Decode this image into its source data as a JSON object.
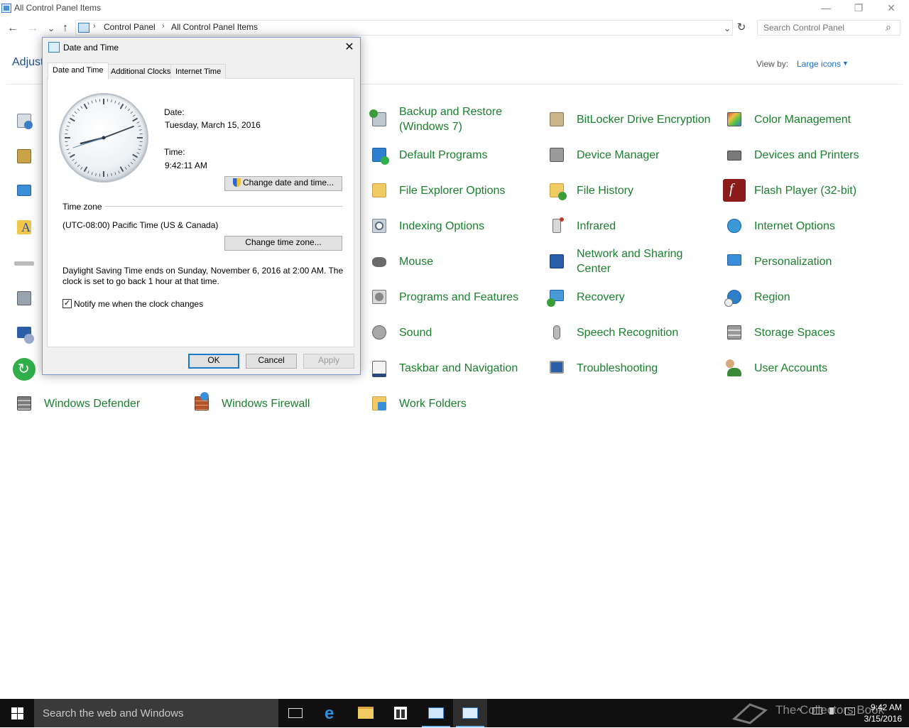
{
  "window": {
    "title": "All Control Panel Items",
    "minimize": "—",
    "restore": "❐",
    "close": "✕"
  },
  "nav": {
    "back": "←",
    "forward": "→",
    "recent": "⌄",
    "up": "↑",
    "breadcrumb": [
      "Control Panel",
      "All Control Panel Items"
    ],
    "separator": "›",
    "dropdown": "⌄",
    "refresh": "↻",
    "search_placeholder": "Search Control Panel",
    "search_icon": "⌕"
  },
  "header": {
    "adjust_text": "Adjust",
    "view_by_label": "View by:",
    "view_by_value": "Large icons",
    "view_by_caret": "▼"
  },
  "items": [
    {
      "label": "Backup and Restore (Windows 7)",
      "icon": "backup-icon",
      "color": "#3a9d3a"
    },
    {
      "label": "BitLocker Drive Encryption",
      "icon": "bitlocker-icon",
      "color": "#9a8a6a"
    },
    {
      "label": "Color Management",
      "icon": "color-management-icon",
      "color": "#5a7bd0"
    },
    {
      "label": "Default Programs",
      "icon": "default-programs-icon",
      "color": "#2e7fd0"
    },
    {
      "label": "Device Manager",
      "icon": "device-manager-icon",
      "color": "#7a7a7a"
    },
    {
      "label": "Devices and Printers",
      "icon": "printer-icon",
      "color": "#6a6a6a"
    },
    {
      "label": "File Explorer Options",
      "icon": "folder-options-icon",
      "color": "#e3b94a"
    },
    {
      "label": "File History",
      "icon": "file-history-icon",
      "color": "#e3b94a"
    },
    {
      "label": "Flash Player (32-bit)",
      "icon": "flash-icon",
      "color": "#8b1a1a"
    },
    {
      "label": "Indexing Options",
      "icon": "indexing-icon",
      "color": "#8a9aa8"
    },
    {
      "label": "Infrared",
      "icon": "infrared-icon",
      "color": "#c0392b"
    },
    {
      "label": "Internet Options",
      "icon": "internet-options-icon",
      "color": "#2f8fd0"
    },
    {
      "label": "Mouse",
      "icon": "mouse-icon",
      "color": "#555555"
    },
    {
      "label": "Network and Sharing Center",
      "icon": "network-icon",
      "color": "#2a5fa8"
    },
    {
      "label": "Personalization",
      "icon": "personalization-icon",
      "color": "#3a8fd8"
    },
    {
      "label": "Programs and Features",
      "icon": "programs-icon",
      "color": "#8a8a8a"
    },
    {
      "label": "Recovery",
      "icon": "recovery-icon",
      "color": "#3a8fd8"
    },
    {
      "label": "Region",
      "icon": "region-icon",
      "color": "#2f7fc8"
    },
    {
      "label": "Sound",
      "icon": "sound-icon",
      "color": "#888888"
    },
    {
      "label": "Speech Recognition",
      "icon": "microphone-icon",
      "color": "#999999"
    },
    {
      "label": "Storage Spaces",
      "icon": "storage-icon",
      "color": "#8a8a8a"
    },
    {
      "label": "Taskbar and Navigation",
      "icon": "taskbar-nav-icon",
      "color": "#2a4a7a"
    },
    {
      "label": "Troubleshooting",
      "icon": "troubleshooting-icon",
      "color": "#2a5fa8"
    },
    {
      "label": "User Accounts",
      "icon": "user-accounts-icon",
      "color": "#3a8a3a"
    },
    {
      "label": "Windows Defender",
      "icon": "defender-icon",
      "color": "#6a6a6a"
    },
    {
      "label": "Windows Firewall",
      "icon": "firewall-icon",
      "color": "#b5542a"
    },
    {
      "label": "Work Folders",
      "icon": "work-folders-icon",
      "color": "#e3b94a"
    }
  ],
  "dialog": {
    "title": "Date and Time",
    "close": "✕",
    "tabs": [
      "Date and Time",
      "Additional Clocks",
      "Internet Time"
    ],
    "date_label": "Date:",
    "date_value": "Tuesday, March 15, 2016",
    "time_label": "Time:",
    "time_value": "9:42:11 AM",
    "change_datetime_button": "Change date and time...",
    "timezone_heading": "Time zone",
    "timezone_value": "(UTC-08:00) Pacific Time (US & Canada)",
    "change_timezone_button": "Change time zone...",
    "dst_line1": "Daylight Saving Time ends on Sunday, November 6, 2016 at 2:00 AM. The",
    "dst_line2": "clock is set to go back 1 hour at that time.",
    "notify_checked": true,
    "notify_checkmark": "✓",
    "notify_label": "Notify me when the clock changes",
    "ok_button": "OK",
    "cancel_button": "Cancel",
    "apply_button": "Apply"
  },
  "taskbar": {
    "search_text": "Search the web and Windows",
    "time": "9:42 AM",
    "date": "3/15/2016",
    "tray_chevron": "^",
    "watermark": "The Collectors Book"
  }
}
